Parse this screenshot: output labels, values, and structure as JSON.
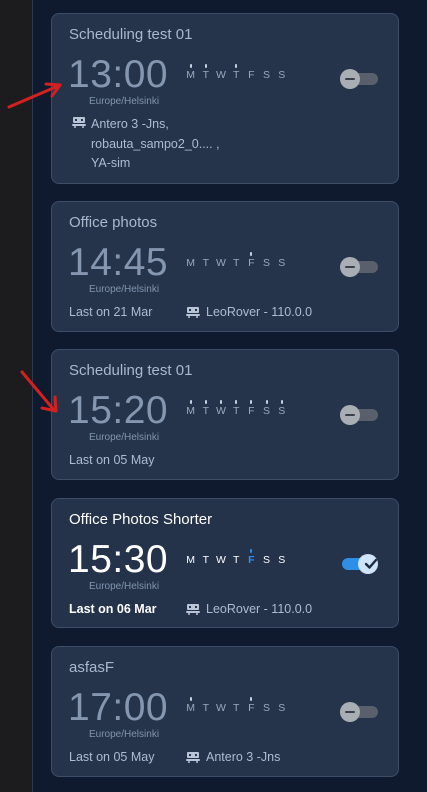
{
  "day_letters": [
    "M",
    "T",
    "W",
    "T",
    "F",
    "S",
    "S"
  ],
  "colors": {
    "accent": "#2d8ff0",
    "card_bg": "#26344b",
    "page_bg": "#0f1a2e"
  },
  "schedules": [
    {
      "title": "Scheduling test 01",
      "time": "13:00",
      "timezone": "Europe/Helsinki",
      "enabled": false,
      "last_run": "",
      "robots": [
        "Antero 3 -Jns,",
        "robauta_sampo2_0.... ,",
        "YA-sim"
      ],
      "robot": ""
    },
    {
      "title": "Office photos",
      "time": "14:45",
      "timezone": "Europe/Helsinki",
      "enabled": false,
      "last_run": "Last on 21 Mar",
      "robot": "LeoRover - 110.0.0"
    },
    {
      "title": "Scheduling test 01",
      "time": "15:20",
      "timezone": "Europe/Helsinki",
      "enabled": false,
      "last_run": "Last on 05 May",
      "robot": ""
    },
    {
      "title": "Office Photos Shorter",
      "time": "15:30",
      "timezone": "Europe/Helsinki",
      "enabled": true,
      "last_run": "Last on 06 Mar",
      "robot": "LeoRover - 110.0.0"
    },
    {
      "title": "asfasF",
      "time": "17:00",
      "timezone": "Europe/Helsinki",
      "enabled": false,
      "last_run": "Last on 05 May",
      "robot": "Antero 3 -Jns"
    }
  ]
}
